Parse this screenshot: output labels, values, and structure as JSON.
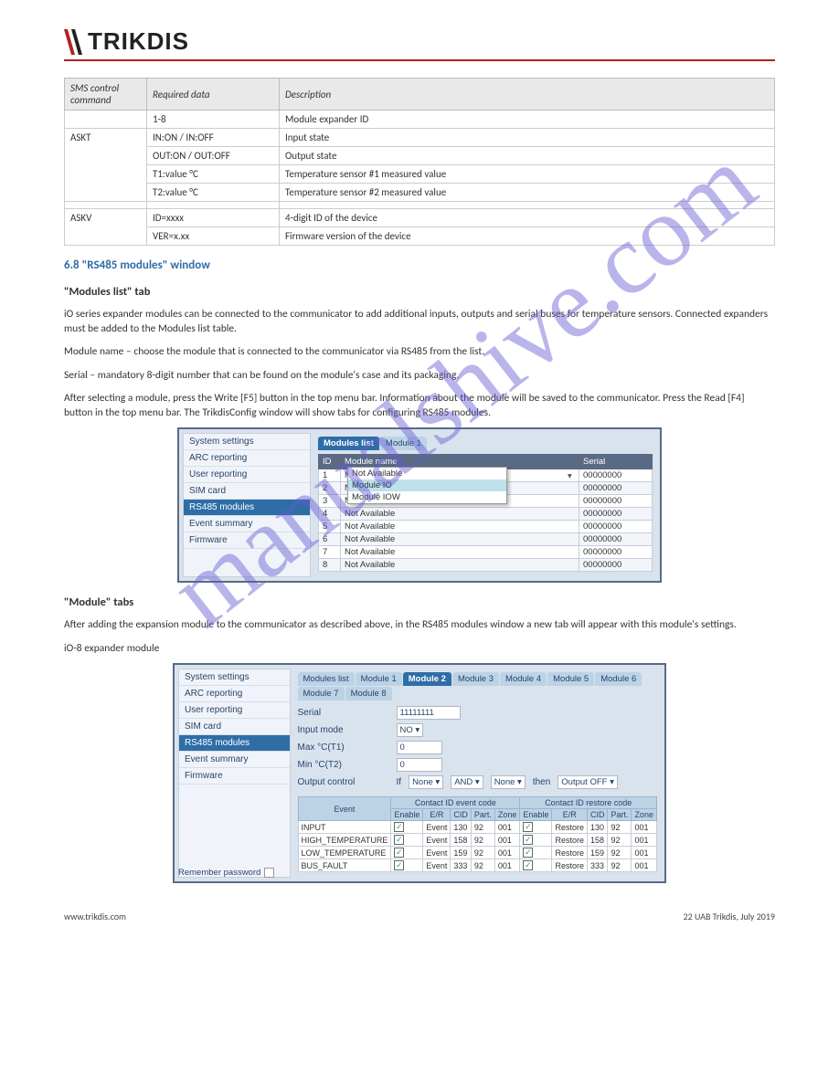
{
  "watermark": "manualshive.com",
  "header": {
    "brand": "TRIKDIS"
  },
  "smsTable": {
    "headers": [
      "SMS control command",
      "Required data",
      "Description"
    ],
    "group1cmd": "ASKT",
    "group1": [
      {
        "data": "1-8",
        "desc": "Module expander ID"
      },
      {
        "data": "IN:ON / IN:OFF",
        "desc": "Input state"
      },
      {
        "data": "OUT:ON / OUT:OFF",
        "desc": "Output state"
      },
      {
        "data": "T1:value °C",
        "desc": "Temperature sensor #1 measured value"
      },
      {
        "data": "T2:value °C",
        "desc": "Temperature sensor #2 measured value"
      }
    ],
    "group2cmd": "ASKV",
    "group2": [
      {
        "data": "ID=xxxx",
        "desc": "4-digit ID of the device"
      },
      {
        "data": "VER=x.xx",
        "desc": "Firmware version of the device"
      }
    ]
  },
  "sections": {
    "rs485": {
      "heading": "6.8   \"RS485 modules\" window",
      "subheading1": "\"Modules list\" tab",
      "p1": "iO series expander modules can be connected to the communicator to add additional inputs, outputs and serial buses for temperature sensors. Connected expanders must be added to the Modules list table.",
      "p2": "Module name – choose the module that is connected to the communicator via RS485 from the list.",
      "p3": "Serial – mandatory 8-digit number that can be found on the module's case and its packaging.",
      "p4": "After selecting a module, press the Write [F5] button in the top menu bar. Information about the module will be saved to the communicator. Press the Read [F4] button in the top menu bar. The TrikdisConfig window will show tabs for configuring RS485 modules.",
      "subheading2": "\"Module\" tabs",
      "p5": "After adding the expansion module to the communicator as described above, in the RS485 modules window a new tab will appear with this module's settings.",
      "p6": "iO-8 expander module"
    }
  },
  "shot1": {
    "sidebar": [
      "System settings",
      "ARC reporting",
      "User reporting",
      "SIM card",
      "RS485 modules",
      "Event summary",
      "Firmware"
    ],
    "tabs": [
      "Modules list",
      "Module 1"
    ],
    "table": {
      "headers": [
        "ID",
        "Module name",
        "Serial"
      ],
      "rows": [
        {
          "id": "1",
          "name": "Module IO",
          "serial": "00000000"
        },
        {
          "id": "2",
          "name": "Not Available",
          "serial": "00000000"
        },
        {
          "id": "3",
          "name": "Not Available",
          "serial": "00000000"
        },
        {
          "id": "4",
          "name": "Not Available",
          "serial": "00000000"
        },
        {
          "id": "5",
          "name": "Not Available",
          "serial": "00000000"
        },
        {
          "id": "6",
          "name": "Not Available",
          "serial": "00000000"
        },
        {
          "id": "7",
          "name": "Not Available",
          "serial": "00000000"
        },
        {
          "id": "8",
          "name": "Not Available",
          "serial": "00000000"
        }
      ]
    },
    "dropdown": [
      "Not Available",
      "Module IO",
      "Module IOW"
    ]
  },
  "shot2": {
    "sidebar": [
      "System settings",
      "ARC reporting",
      "User reporting",
      "SIM card",
      "RS485 modules",
      "Event summary",
      "Firmware"
    ],
    "remember": "Remember password",
    "tabs": [
      "Modules list",
      "Module 1",
      "Module 2",
      "Module 3",
      "Module 4",
      "Module 5",
      "Module 6",
      "Module 7",
      "Module 8"
    ],
    "form": {
      "serial_lbl": "Serial",
      "serial_val": "11111111",
      "input_lbl": "Input mode",
      "input_val": "NO",
      "max_lbl": "Max °C(T1)",
      "max_val": "0",
      "min_lbl": "Min °C(T2)",
      "min_val": "0",
      "out_lbl": "Output control",
      "if": "If",
      "cond1": "None",
      "op": "AND",
      "cond2": "None",
      "then": "then",
      "action": "Output OFF"
    },
    "evt": {
      "h": {
        "event": "Event",
        "left": "Contact ID event code",
        "right": "Contact ID restore code",
        "enable": "Enable",
        "er": "E/R",
        "cid": "CID",
        "part": "Part.",
        "zone": "Zone"
      },
      "rows": [
        {
          "name": "INPUT",
          "er1": "Event",
          "er2": "Restore",
          "cid": "130",
          "part": "92",
          "zone": "001"
        },
        {
          "name": "HIGH_TEMPERATURE",
          "er1": "Event",
          "er2": "Restore",
          "cid": "158",
          "part": "92",
          "zone": "001"
        },
        {
          "name": "LOW_TEMPERATURE",
          "er1": "Event",
          "er2": "Restore",
          "cid": "159",
          "part": "92",
          "zone": "001"
        },
        {
          "name": "BUS_FAULT",
          "er1": "Event",
          "er2": "Restore",
          "cid": "333",
          "part": "92",
          "zone": "001"
        }
      ]
    }
  },
  "footer": {
    "left": "www.trikdis.com",
    "right": "22    UAB Trikdis, July 2019"
  }
}
